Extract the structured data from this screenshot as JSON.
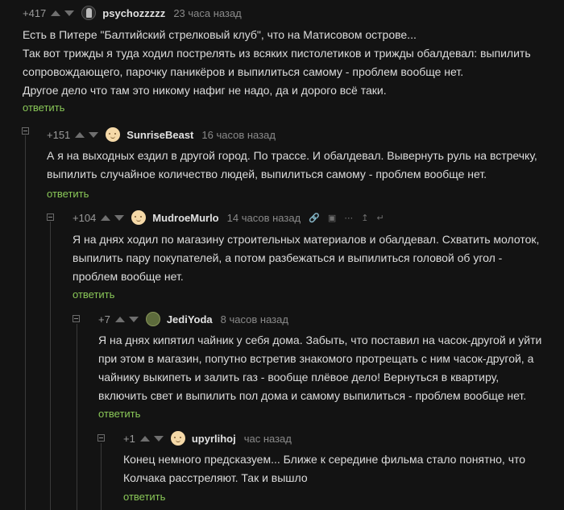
{
  "comments": [
    {
      "rating": "+417",
      "username": "psychozzzzz",
      "time": "23 часа назад",
      "lines": [
        "Есть в Питере \"Балтийский стрелковый клуб\", что на Матисовом острове...",
        "Так вот трижды я туда ходил пострелять из всяких пистолетиков и трижды обалдевал: выпилить",
        "сопровождающего, парочку паникёров и выпилиться самому - проблем вообще нет.",
        "Другое дело что там это никому нафиг не надо, да и дорого всё таки."
      ],
      "reply": "ответить"
    },
    {
      "rating": "+151",
      "username": "SunriseBeast",
      "time": "16 часов назад",
      "lines": [
        "А я на выходных ездил в другой город. По трассе. И обалдевал. Вывернуть руль на встречку,",
        "выпилить случайное количество людей, выпилиться самому - проблем вообще нет."
      ],
      "reply": "ответить"
    },
    {
      "rating": "+104",
      "username": "MudroeMurlo",
      "time": "14 часов назад",
      "lines": [
        "Я на днях ходил по магазину строительных материалов и обалдевал. Схватить молоток,",
        "выпилить пару покупателей, а потом разбежаться и выпилиться головой об угол -",
        "проблем вообще нет."
      ],
      "reply": "ответить"
    },
    {
      "rating": "+7",
      "username": "JediYoda",
      "time": "8 часов назад",
      "lines": [
        "Я на днях кипятил чайник у себя дома. Забыть, что поставил на часок-другой и уйти",
        "при этом в магазин, попутно встретив знакомого протрещать с ним часок-другой, а",
        "чайнику выкипеть и залить газ - вообще плёвое дело! Вернуться в квартиру,",
        "включить свет и выпилить пол дома и самому выпилиться - проблем вообще нет."
      ],
      "reply": "ответить"
    },
    {
      "rating": "+1",
      "username": "upyrlihoj",
      "time": "час назад",
      "lines": [
        "Конец немного предсказуем... Ближе к середине фильма стало понятно, что",
        "Колчака расстреляют. Так и вышло"
      ],
      "reply": "ответить"
    }
  ],
  "icons": [
    "link-icon",
    "save-icon",
    "more-icon",
    "branch-up-icon",
    "comment-reply-icon"
  ],
  "colors": {
    "background": "#131313",
    "reply_link": "#8ac858",
    "text": "#dcdcdc"
  }
}
